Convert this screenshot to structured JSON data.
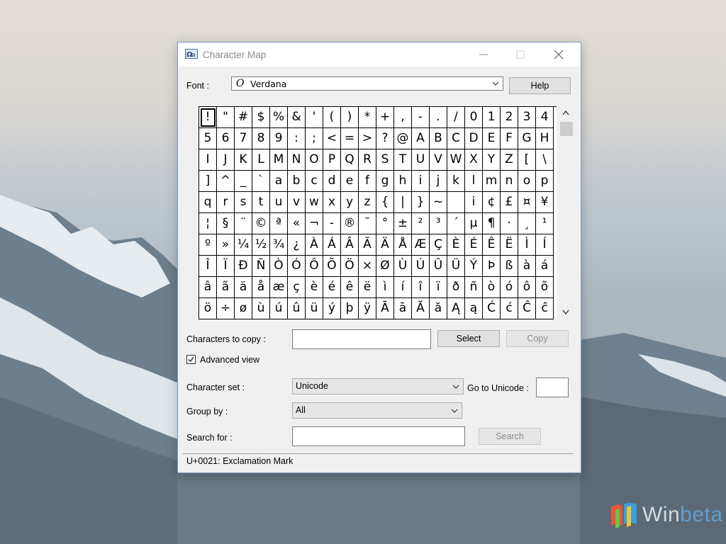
{
  "window": {
    "title": "Character Map"
  },
  "font_row": {
    "label": "Font :",
    "selected_font": "Verdana",
    "font_type_glyph": "O",
    "help_label": "Help"
  },
  "grid": {
    "selected_index": 0,
    "cells": [
      "!",
      "\"",
      "#",
      "$",
      "%",
      "&",
      "'",
      "(",
      ")",
      "*",
      "+",
      ",",
      "-",
      ".",
      "/",
      "0",
      "1",
      "2",
      "3",
      "4",
      "5",
      "6",
      "7",
      "8",
      "9",
      ":",
      ";",
      "<",
      "=",
      ">",
      "?",
      "@",
      "A",
      "B",
      "C",
      "D",
      "E",
      "F",
      "G",
      "H",
      "I",
      "J",
      "K",
      "L",
      "M",
      "N",
      "O",
      "P",
      "Q",
      "R",
      "S",
      "T",
      "U",
      "V",
      "W",
      "X",
      "Y",
      "Z",
      "[",
      "\\",
      "]",
      "^",
      "_",
      "`",
      "a",
      "b",
      "c",
      "d",
      "e",
      "f",
      "g",
      "h",
      "i",
      "j",
      "k",
      "l",
      "m",
      "n",
      "o",
      "p",
      "q",
      "r",
      "s",
      "t",
      "u",
      "v",
      "w",
      "x",
      "y",
      "z",
      "{",
      "|",
      "}",
      "~",
      "",
      "i",
      "¢",
      "£",
      "¤",
      "¥",
      "¦",
      "§",
      "¨",
      "©",
      "ª",
      "«",
      "¬",
      "-",
      "®",
      "¯",
      "°",
      "±",
      "²",
      "³",
      "´",
      "µ",
      "¶",
      "·",
      "¸",
      "¹",
      "º",
      "»",
      "¼",
      "½",
      "¾",
      "¿",
      "À",
      "Á",
      "Â",
      "Ã",
      "Ä",
      "Å",
      "Æ",
      "Ç",
      "È",
      "É",
      "Ê",
      "Ë",
      "Ì",
      "Í",
      "Î",
      "Ï",
      "Ð",
      "Ñ",
      "Ò",
      "Ó",
      "Ô",
      "Õ",
      "Ö",
      "×",
      "Ø",
      "Ù",
      "Ú",
      "Û",
      "Ü",
      "Ý",
      "Þ",
      "ß",
      "à",
      "á",
      "â",
      "ã",
      "ä",
      "å",
      "æ",
      "ç",
      "è",
      "é",
      "ê",
      "ë",
      "ì",
      "í",
      "î",
      "ï",
      "ð",
      "ñ",
      "ò",
      "ó",
      "ô",
      "õ",
      "ö",
      "÷",
      "ø",
      "ù",
      "ú",
      "û",
      "ü",
      "ý",
      "þ",
      "ÿ",
      "Ā",
      "ā",
      "Ă",
      "ă",
      "Ą",
      "ą",
      "Ć",
      "ć",
      "Ĉ",
      "ĉ"
    ]
  },
  "copy_row": {
    "label": "Characters to copy :",
    "value": "",
    "select_label": "Select",
    "copy_label": "Copy"
  },
  "advanced_view": {
    "label": "Advanced view",
    "checked": true
  },
  "character_set": {
    "label": "Character set :",
    "value": "Unicode",
    "goto_label": "Go to Unicode :",
    "goto_value": ""
  },
  "group_by": {
    "label": "Group by :",
    "value": "All"
  },
  "search": {
    "label": "Search for :",
    "value": "",
    "button_label": "Search"
  },
  "status": {
    "text": "U+0021: Exclamation Mark"
  },
  "watermark": {
    "word": "Win",
    "word_tail": "beta"
  },
  "colors": {
    "window_bg": "#f0f0f0",
    "titlebar_bg": "#ffffff",
    "border": "#7a9cc0"
  }
}
